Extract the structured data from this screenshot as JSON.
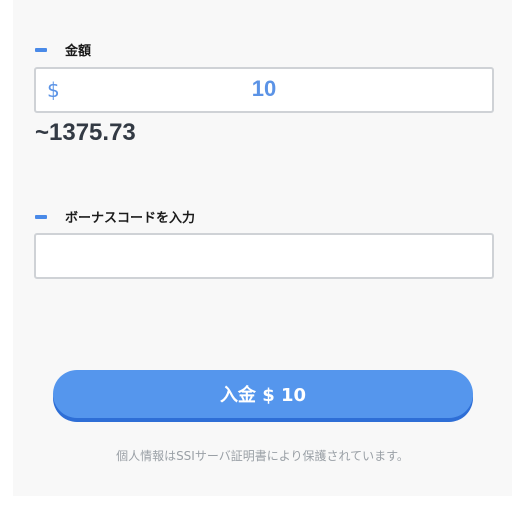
{
  "amount": {
    "label": "金額",
    "currency_symbol": "$",
    "value": "10",
    "converted": "~1375.73"
  },
  "bonus": {
    "label": "ボーナスコードを入力",
    "value": ""
  },
  "deposit_button": {
    "label": "入金 $ 10"
  },
  "security_note": "個人情報はSSIサーバ証明書により保護されています。",
  "colors": {
    "accent": "#5596ed",
    "button_shadow": "#2e6ed6",
    "panel_bg": "#f8f8f8",
    "input_border": "#cfd2d6",
    "value_text": "#5b93e6"
  }
}
